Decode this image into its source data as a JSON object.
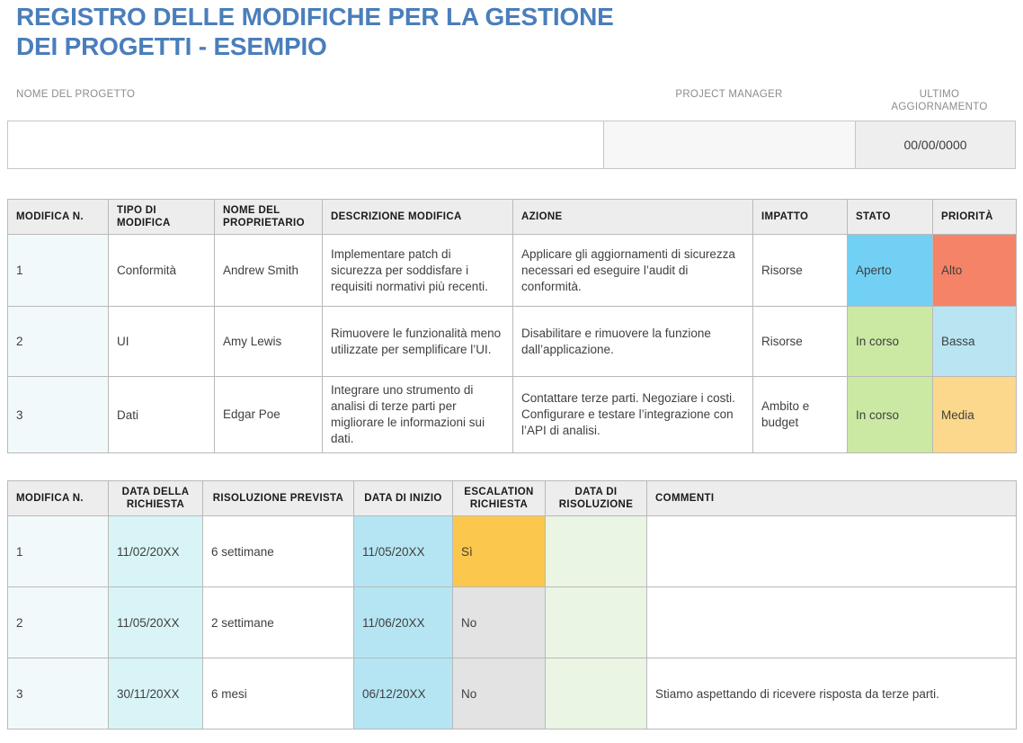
{
  "title": {
    "line1": "REGISTRO DELLE MODIFICHE PER LA GESTIONE",
    "line2": "DEI PROGETTI - ESEMPIO",
    "color": "#4a7ebb"
  },
  "header": {
    "project_name_label": "NOME DEL PROGETTO",
    "project_manager_label": "PROJECT MANAGER",
    "last_update_label_line1": "ULTIMO",
    "last_update_label_line2": "AGGIORNAMENTO",
    "project_name_value": "",
    "project_manager_value": "",
    "last_update_value": "00/00/0000"
  },
  "table1": {
    "headers": [
      "MODIFICA N.",
      "TIPO DI MODIFICA",
      "NOME DEL PROPRIETARIO",
      "DESCRIZIONE MODIFICA",
      "AZIONE",
      "IMPATTO",
      "STATO",
      "PRIORITÀ"
    ],
    "rows": [
      {
        "num": "1",
        "tipo": "Conformità",
        "proprietario": "Andrew Smith",
        "descrizione": "Implementare patch di sicurezza per soddisfare i requisiti normativi più recenti.",
        "azione": "Applicare gli aggiornamenti di sicurezza necessari ed eseguire l’audit di conformità.",
        "impatto": "Risorse",
        "stato": "Aperto",
        "priorita": "Alto"
      },
      {
        "num": "2",
        "tipo": "UI",
        "proprietario": "Amy Lewis",
        "descrizione": "Rimuovere le funzionalità meno utilizzate per semplificare l’UI.",
        "azione": "Disabilitare e rimuovere la funzione dall’applicazione.",
        "impatto": "Risorse",
        "stato": "In corso",
        "priorita": "Bassa"
      },
      {
        "num": "3",
        "tipo": "Dati",
        "proprietario": "Edgar Poe",
        "descrizione": "Integrare uno strumento di analisi di terze parti per migliorare le informazioni sui dati.",
        "azione": "Contattare terze parti. Negoziare i costi. Configurare e testare l’integrazione con l’API di analisi.",
        "impatto": "Ambito e budget",
        "stato": "In corso",
        "priorita": "Media"
      }
    ]
  },
  "table2": {
    "headers": [
      "MODIFICA N.",
      "DATA DELLA RICHIESTA",
      "RISOLUZIONE PREVISTA",
      "DATA DI INIZIO",
      "ESCALATION RICHIESTA",
      "DATA DI RISOLUZIONE",
      "COMMENTI"
    ],
    "rows": [
      {
        "num": "1",
        "data_richiesta": "11/02/20XX",
        "risoluzione_prevista": "6 settimane",
        "data_inizio": "11/05/20XX",
        "escalation": "Sì",
        "data_risoluzione": "",
        "commenti": ""
      },
      {
        "num": "2",
        "data_richiesta": "11/05/20XX",
        "risoluzione_prevista": "2 settimane",
        "data_inizio": "11/06/20XX",
        "escalation": "No",
        "data_risoluzione": "",
        "commenti": ""
      },
      {
        "num": "3",
        "data_richiesta": "30/11/20XX",
        "risoluzione_prevista": "6 mesi",
        "data_inizio": "06/12/20XX",
        "escalation": "No",
        "data_risoluzione": "",
        "commenti": "Stiamo aspettando di ricevere risposta da terze parti."
      }
    ]
  },
  "colors": {
    "title_blue": "#4a7ebb",
    "header_grey": "#ededed",
    "status_open": "#72d0f4",
    "status_inprogress": "#cbe9a2",
    "priority_high": "#f58367",
    "priority_low": "#b9e5f2",
    "priority_medium": "#fbd88c",
    "escalation_yes": "#fbc74c",
    "escalation_no": "#e3e3e3",
    "date_cyan": "#d9f4f6",
    "date_cyan_bold": "#b5e5f2",
    "resolution_green": "#eaf5e4",
    "num_col": "#f2f9fa"
  }
}
